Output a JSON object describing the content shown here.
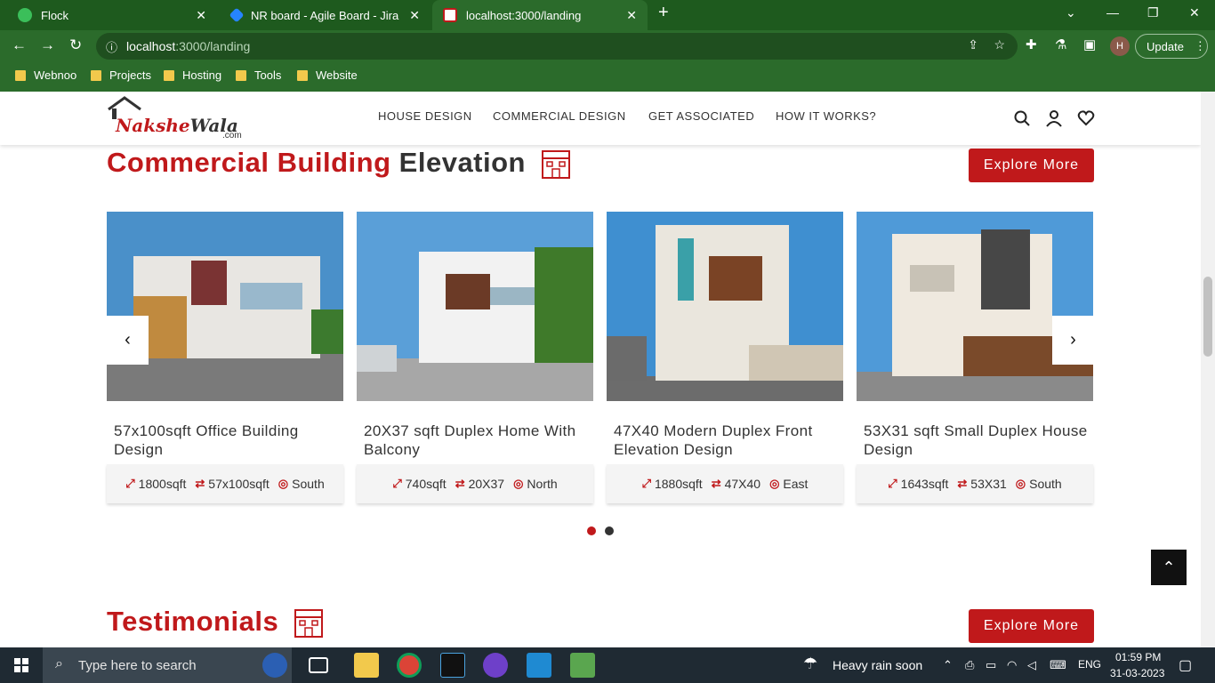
{
  "browser": {
    "tabs": [
      {
        "label": "Flock",
        "active": false
      },
      {
        "label": "NR board - Agile Board - Jira",
        "active": false
      },
      {
        "label": "localhost:3000/landing",
        "active": true
      }
    ],
    "url_host": "localhost",
    "url_path": ":3000/landing",
    "update_label": "Update",
    "profile_initial": "H",
    "bookmarks": [
      "Webnoo",
      "Projects",
      "Hosting",
      "Tools",
      "Website"
    ]
  },
  "site": {
    "logo": {
      "part1": "Nakshe",
      "part2": "Wala",
      "suffix": ".com"
    },
    "nav": [
      "HOUSE DESIGN",
      "COMMERCIAL DESIGN",
      "GET ASSOCIATED",
      "HOW IT WORKS?"
    ]
  },
  "section1": {
    "title_red": "Commercial Building",
    "title_dark": "Elevation",
    "explore_label": "Explore More",
    "cards": [
      {
        "title": "57x100sqft Office Building Design",
        "area": "1800sqft",
        "dims": "57x100sqft",
        "facing": "South"
      },
      {
        "title": "20X37 sqft Duplex Home With Balcony",
        "area": "740sqft",
        "dims": "20X37",
        "facing": "North"
      },
      {
        "title": "47X40 Modern Duplex Front Elevation Design",
        "area": "1880sqft",
        "dims": "47X40",
        "facing": "East"
      },
      {
        "title": "53X31 sqft Small Duplex House Design",
        "area": "1643sqft",
        "dims": "53X31",
        "facing": "South"
      }
    ],
    "prev_icon": "‹",
    "next_icon": "›",
    "active_dot": 0,
    "dot_count": 2
  },
  "section2": {
    "title_red": "Testimonials",
    "explore_label": "Explore More"
  },
  "taskbar": {
    "search_placeholder": "Type here to search",
    "weather": "Heavy rain soon",
    "lang": "ENG",
    "time": "01:59 PM",
    "date": "31-03-2023"
  }
}
